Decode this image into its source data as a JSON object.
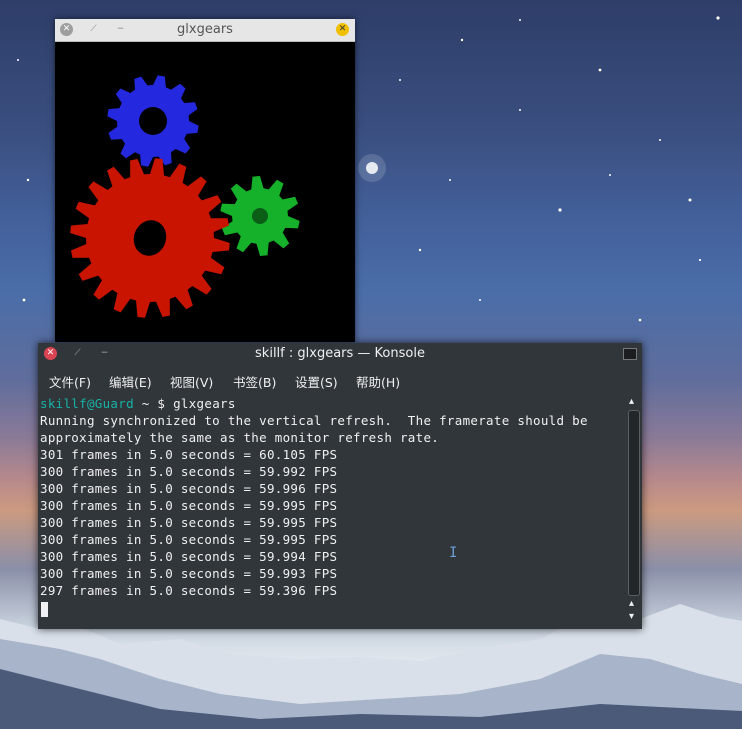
{
  "gears_window": {
    "title": "glxgears",
    "gear_colors": {
      "red": "#c81400",
      "green": "#16b12a",
      "blue": "#2429e0"
    }
  },
  "konsole": {
    "title": "skillf : glxgears — Konsole",
    "menu": [
      "文件(F)",
      "编辑(E)",
      "视图(V)",
      "书签(B)",
      "设置(S)",
      "帮助(H)"
    ],
    "prompt": {
      "user_host": "skillf@Guard",
      "path_symbol": "~ $",
      "command": "glxgears"
    },
    "output": [
      "Running synchronized to the vertical refresh.  The framerate should be",
      "approximately the same as the monitor refresh rate.",
      "301 frames in 5.0 seconds = 60.105 FPS",
      "300 frames in 5.0 seconds = 59.992 FPS",
      "300 frames in 5.0 seconds = 59.996 FPS",
      "300 frames in 5.0 seconds = 59.995 FPS",
      "300 frames in 5.0 seconds = 59.995 FPS",
      "300 frames in 5.0 seconds = 59.995 FPS",
      "300 frames in 5.0 seconds = 59.994 FPS",
      "300 frames in 5.0 seconds = 59.993 FPS",
      "297 frames in 5.0 seconds = 59.396 FPS"
    ],
    "prompt_color": "#18b2a5"
  }
}
